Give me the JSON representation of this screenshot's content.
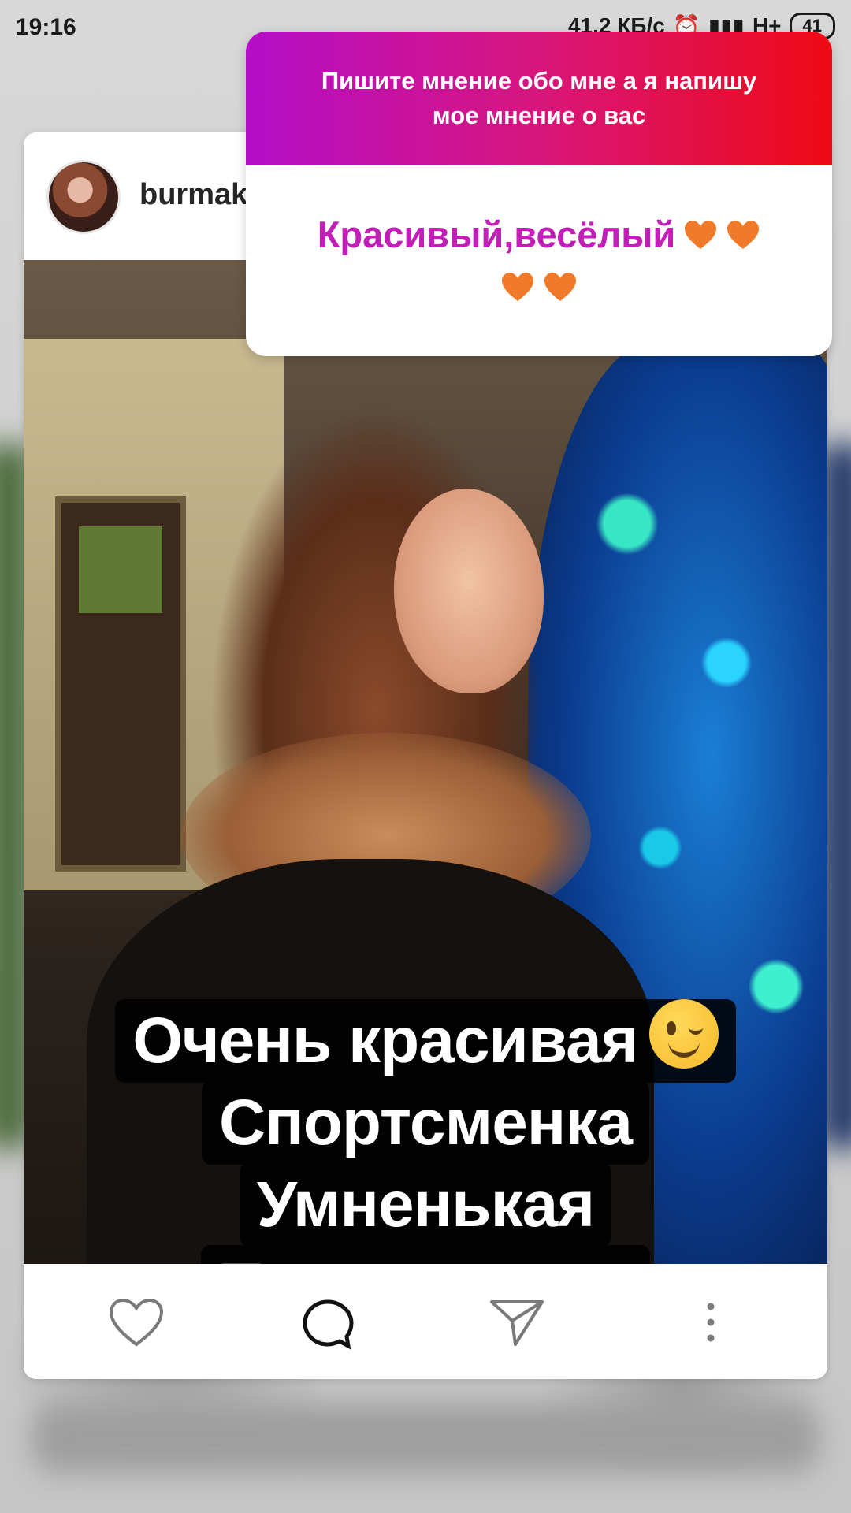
{
  "status_bar": {
    "time": "19:16",
    "speed": "41,2 КБ/с",
    "network": "H+",
    "battery": "41"
  },
  "post": {
    "username": "burmak"
  },
  "sticker": {
    "question": "Пишите мнение обо мне а я напишу мое мнение о вас",
    "answer": "Красивый,весёлый",
    "gradient_colors": [
      "#b40ec8",
      "#d8167c",
      "#ee0a14"
    ],
    "answer_color": "#c11fb7",
    "heart_color": "#f07a2a"
  },
  "answers": {
    "line1": "Очень красивая",
    "line1_emoji": "wink-emoji",
    "line2": "Спортсменка",
    "line3": "Умненькая",
    "line4": "Приветливая"
  },
  "actions": {
    "icons": [
      "heart-icon",
      "comment-icon",
      "send-icon",
      "more-icon"
    ]
  }
}
